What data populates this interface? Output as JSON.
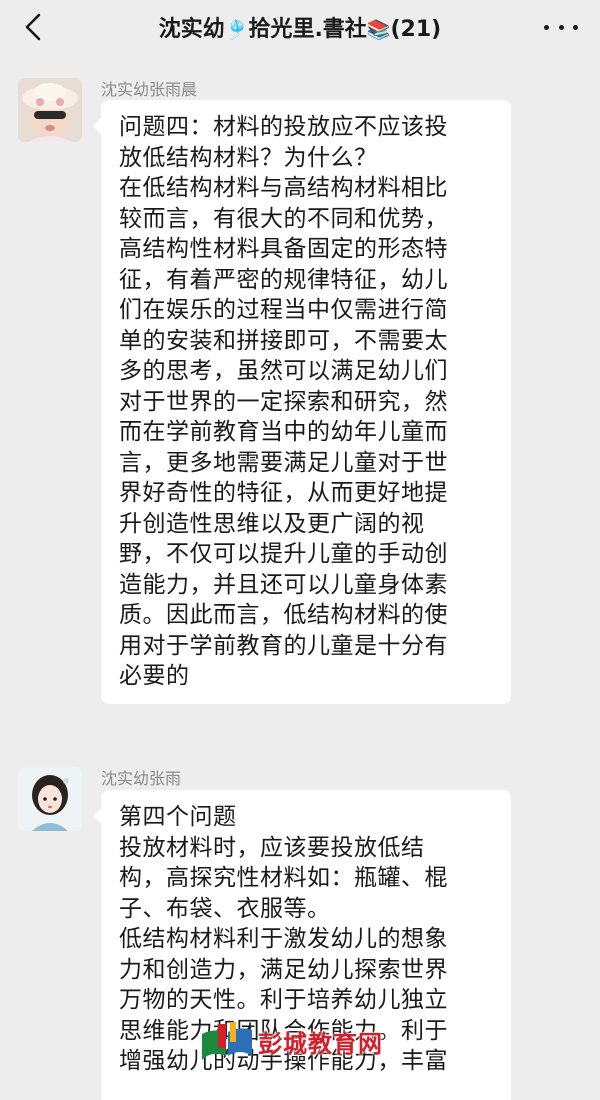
{
  "header": {
    "title_before": "沈实幼",
    "title_middle": "拾光里.書社",
    "title_after": "(21)",
    "title_emoji_1": "🎐",
    "title_emoji_2": "📚"
  },
  "messages": [
    {
      "sender": "沈实幼张雨晨",
      "lines": [
        "问题四：材料的投放应不应该投",
        "放低结构材料？为什么？",
        "在低结构材料与高结构材料相比",
        "较而言，有很大的不同和优势，",
        "高结构性材料具备固定的形态特",
        "征，有着严密的规律特征，幼儿",
        "们在娱乐的过程当中仅需进行简",
        "单的安装和拼接即可，不需要太",
        "多的思考，虽然可以满足幼儿们",
        "对于世界的一定探索和研究，然",
        "而在学前教育当中的幼年儿童而",
        "言，更多地需要满足儿童对于世",
        "界好奇性的特征，从而更好地提",
        "升创造性思维以及更广阔的视",
        "野，不仅可以提升儿童的手动创",
        "造能力，并且还可以儿童身体素",
        "质。因此而言，低结构材料的使",
        "用对于学前教育的儿童是十分有",
        "必要的"
      ]
    },
    {
      "sender": "沈实幼张雨",
      "lines": [
        "第四个问题",
        "投放材料时，应该要投放低结",
        "构，高探究性材料如：瓶罐、棍",
        "子、布袋、衣服等。",
        "低结构材料利于激发幼儿的想象",
        "力和创造力，满足幼儿探索世界",
        "万物的天性。利于培养幼儿独立",
        "思维能力和团队合作能力。利于",
        "增强幼儿的动手操作能力，丰富"
      ]
    }
  ],
  "watermark": {
    "text": "彭城教育网"
  },
  "colors": {
    "background": "#ededed",
    "bubble": "#ffffff",
    "sender": "#8a8a8a",
    "watermark": "#d21f2a"
  }
}
